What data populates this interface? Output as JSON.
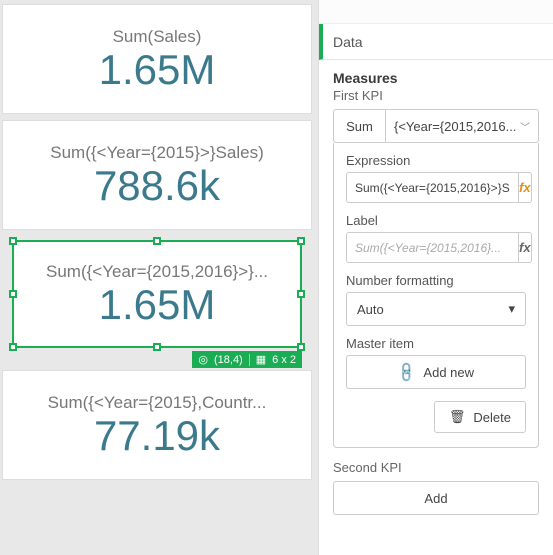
{
  "canvas": {
    "cards": [
      {
        "label": "Sum(Sales)",
        "value": "1.65M"
      },
      {
        "label": "Sum({<Year={2015}>}Sales)",
        "value": "788.6k"
      },
      {
        "label": "Sum({<Year={2015,2016}>}...",
        "value": "1.65M"
      },
      {
        "label": "Sum({<Year={2015},Countr...",
        "value": "77.19k"
      }
    ],
    "selection_badge": {
      "pos": "(18,4)",
      "size": "6 x 2"
    }
  },
  "panel": {
    "accordion": "Data",
    "measures": {
      "title": "Measures",
      "first_label": "First KPI",
      "agg": "Sum",
      "expr_short": "{<Year={2015,2016...",
      "expression_label": "Expression",
      "expression_value": "Sum({<Year={2015,2016}>}S",
      "label_label": "Label",
      "label_placeholder": "Sum({<Year={2015,2016}...",
      "numfmt_label": "Number formatting",
      "numfmt_value": "Auto",
      "master_label": "Master item",
      "addnew": "Add new",
      "delete": "Delete",
      "second_label": "Second KPI",
      "add": "Add"
    }
  }
}
